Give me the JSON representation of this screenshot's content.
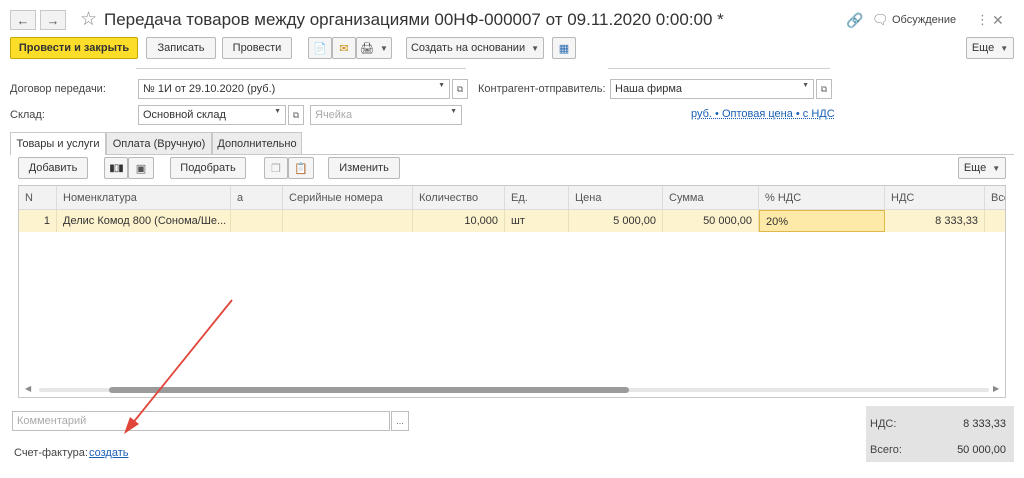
{
  "window": {
    "title": "Передача товаров между организациями 00НФ-000007 от 09.11.2020 0:00:00 *",
    "discussion_label": "Обсуждение"
  },
  "toolbar": {
    "post_close": "Провести и закрыть",
    "save": "Записать",
    "post": "Провести",
    "create_basis": "Создать на основании",
    "more": "Еще"
  },
  "form": {
    "contract_label": "Договор передачи:",
    "contract_value": "№ 1И от 29.10.2020 (руб.)",
    "sender_label": "Контрагент-отправитель:",
    "sender_value": "Наша фирма",
    "warehouse_label": "Склад:",
    "warehouse_value": "Основной склад",
    "cell_placeholder": "Ячейка",
    "price_link": "руб. • Оптовая цена • с НДС"
  },
  "tabs": [
    {
      "label": "Товары и услуги"
    },
    {
      "label": "Оплата (Вручную)"
    },
    {
      "label": "Дополнительно"
    }
  ],
  "table_toolbar": {
    "add": "Добавить",
    "pick": "Подобрать",
    "change": "Изменить",
    "more": "Еще"
  },
  "table": {
    "headers": [
      "N",
      "Номенклатура",
      "а",
      "Серийные номера",
      "Количество",
      "Ед.",
      "Цена",
      "Сумма",
      "% НДС",
      "НДС",
      "Всег"
    ],
    "rows": [
      [
        "1",
        "Делис Комод 800 (Сонома/Ше...",
        "",
        "",
        "10,000",
        "шт",
        "5 000,00",
        "50 000,00",
        "20%",
        "8 333,33",
        ""
      ]
    ]
  },
  "footer": {
    "comment_placeholder": "Комментарий",
    "comment_btn": "...",
    "invoice_label": "Счет-фактура:",
    "invoice_link": "создать",
    "vat_label": "НДС:",
    "vat_value": "8 333,33",
    "total_label": "Всего:",
    "total_value": "50 000,00"
  },
  "colors": {
    "primary_button": "#fcdd2a",
    "selected_row": "#fdf3cf",
    "link": "#1a5fb4",
    "annotation_arrow": "#e0463a"
  }
}
